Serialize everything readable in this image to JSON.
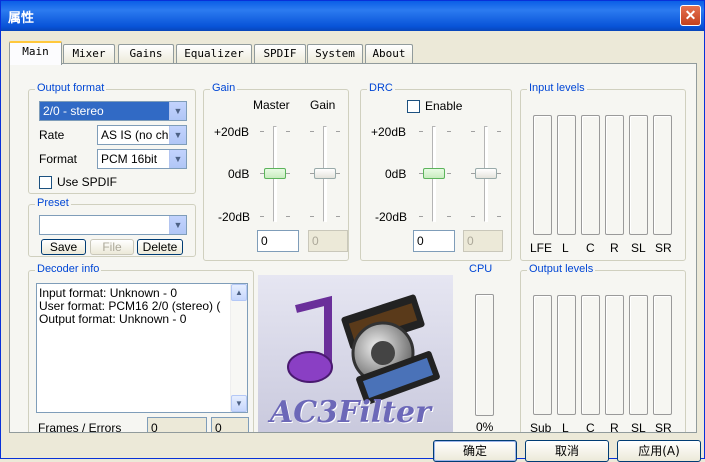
{
  "window": {
    "title": "属性",
    "close_label": "✕"
  },
  "tabs": [
    "Main",
    "Mixer",
    "Gains",
    "Equalizer",
    "SPDIF",
    "System",
    "About"
  ],
  "output_format": {
    "title": "Output format",
    "format_combo": "2/0 - stereo",
    "rate_label": "Rate",
    "rate_value": "AS IS (no ch",
    "format_label": "Format",
    "format_value": "PCM 16bit",
    "use_spdif_label": "Use SPDIF"
  },
  "preset": {
    "title": "Preset",
    "value": "",
    "save": "Save",
    "file": "File",
    "delete": "Delete"
  },
  "gain": {
    "title": "Gain",
    "master_label": "Master",
    "gain_label": "Gain",
    "top_label": "+20dB",
    "mid_label": "0dB",
    "bottom_label": "-20dB",
    "master_value": "0",
    "gain_value": "0"
  },
  "drc": {
    "title": "DRC",
    "enable_label": "Enable",
    "top_label": "+20dB",
    "mid_label": "0dB",
    "bottom_label": "-20dB",
    "value": "0",
    "value2": "0"
  },
  "input_levels": {
    "title": "Input levels",
    "channels": [
      "LFE",
      "L",
      "C",
      "R",
      "SL",
      "SR"
    ]
  },
  "decoder_info": {
    "title": "Decoder info",
    "lines": [
      "Input format: Unknown - 0",
      "User format: PCM16 2/0 (stereo) (",
      "Output format: Unknown - 0"
    ],
    "frames_label": "Frames / Errors",
    "frames_value": "0",
    "errors_value": "0"
  },
  "logo": {
    "text": "AC3Filter"
  },
  "cpu": {
    "title": "CPU",
    "value": "0%"
  },
  "output_levels": {
    "title": "Output levels",
    "channels": [
      "Sub",
      "L",
      "C",
      "R",
      "SL",
      "SR"
    ]
  },
  "buttons": {
    "ok": "确定",
    "cancel": "取消",
    "apply": "应用(A)"
  }
}
